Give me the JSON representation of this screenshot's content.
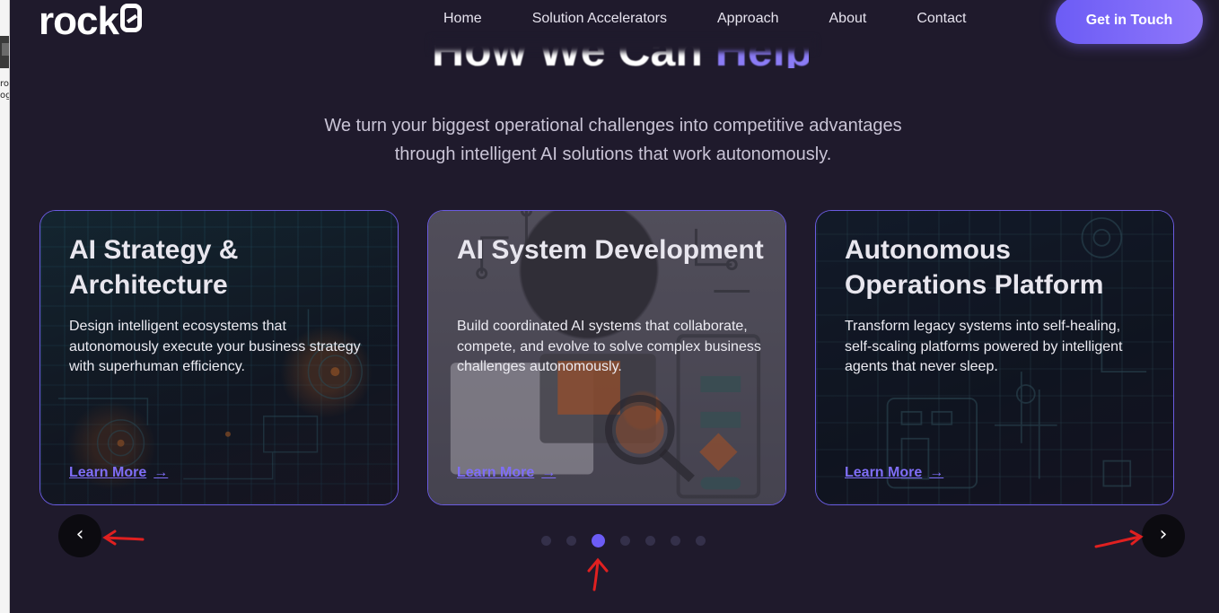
{
  "nav": {
    "logo": "rock8",
    "links": [
      "Home",
      "Solution Accelerators",
      "Approach",
      "About",
      "Contact"
    ],
    "cta": "Get in Touch"
  },
  "hero": {
    "heading_main": "How We Can ",
    "heading_accent": "Help",
    "subtitle_line1": "We turn your biggest operational challenges into competitive advantages",
    "subtitle_line2": "through intelligent AI solutions that work autonomously."
  },
  "cards": [
    {
      "title": "AI Strategy & Architecture",
      "description": "Design intelligent ecosystems that autonomously execute your business strategy with superhuman efficiency.",
      "link": "Learn More"
    },
    {
      "title": "AI System Development",
      "description": "Build coordinated AI systems that collaborate, compete, and evolve to solve complex business challenges autonomously.",
      "link": "Learn More"
    },
    {
      "title": "Autonomous Operations Platform",
      "description": "Transform legacy systems into self-healing, self-scaling platforms powered by intelligent agents that never sleep.",
      "link": "Learn More"
    }
  ],
  "carousel": {
    "prev_icon": "‹",
    "next_icon": "›",
    "slide_count": 7,
    "active_index": 2
  },
  "colors": {
    "background": "#1f1a2c",
    "accent": "#6c5cf5",
    "annotation": "#e02020"
  },
  "left_strip_text": [
    "ro",
    "og"
  ]
}
